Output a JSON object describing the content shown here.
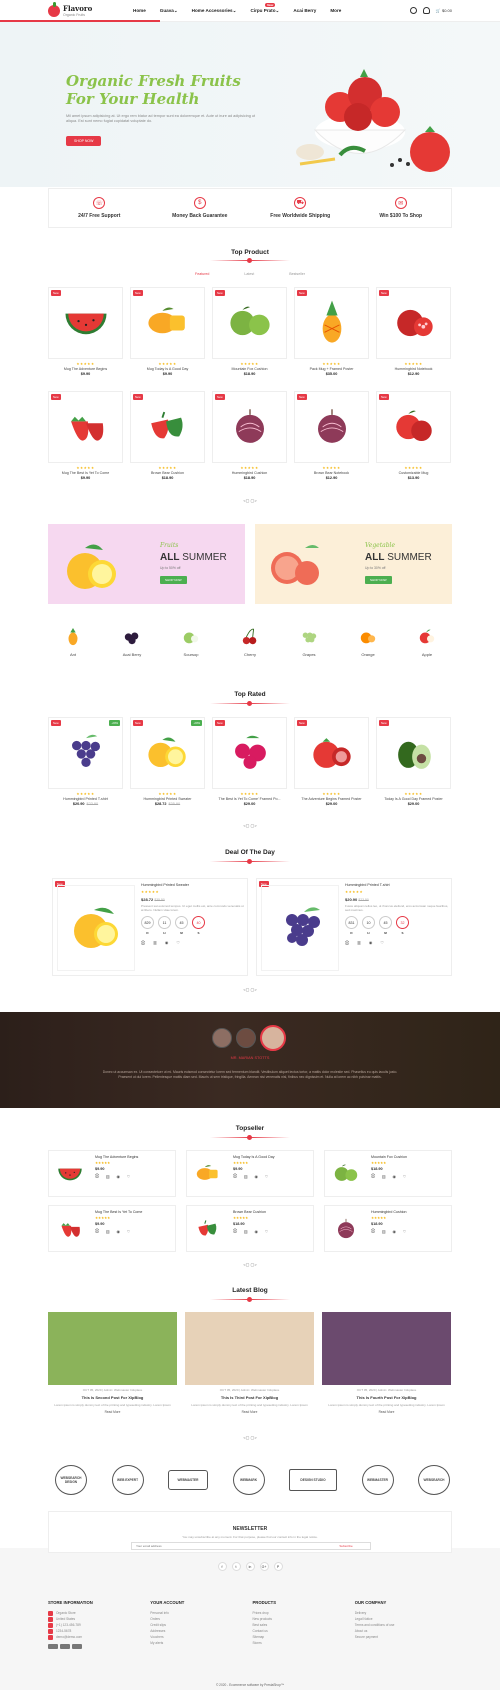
{
  "header": {
    "logo_name": "Flavoro",
    "logo_sub": "Organic Fruits",
    "nav": [
      "Home",
      "Guava",
      "Home Accessories",
      "Cirpu Prato",
      "Acai Berry",
      "More"
    ],
    "nav_badge": "New",
    "cart_label": "$0.00"
  },
  "hero": {
    "title_line1": "Organic Fresh Fruits",
    "title_line2": "For Your Health",
    "text": "Mil amet ipsum adipisicing at. Ut ergo rem blatur ad tempor sunt ea doloremque et. Aute ut irure ad adipisicing ut aliqua. Est sunt nemo fugiat cupidatat voluptate do.",
    "button": "SHOP NOW"
  },
  "features": [
    {
      "icon": "headset-icon",
      "label": "24/7 Free Support"
    },
    {
      "icon": "money-icon",
      "label": "Money Back Guarantee"
    },
    {
      "icon": "truck-icon",
      "label": "Free Worldwide Shipping"
    },
    {
      "icon": "gift-icon",
      "label": "Win $100 To Shop"
    }
  ],
  "top_product": {
    "title": "Top Product",
    "tabs": [
      "Featured",
      "Latest",
      "Bestseller"
    ],
    "row1": [
      {
        "name": "Mug The Adventure Begins",
        "price": "$9.90",
        "badge": "New",
        "fruit": "watermelon"
      },
      {
        "name": "Mug Today Is A Good Day",
        "price": "$9.90",
        "badge": "New",
        "fruit": "mango"
      },
      {
        "name": "Mountain Fox Cushion",
        "price": "$18.90",
        "badge": "New",
        "fruit": "apple-green"
      },
      {
        "name": "Pack Mug + Framed Poster",
        "price": "$35.00",
        "badge": "New",
        "fruit": "pineapple"
      },
      {
        "name": "Hummingbird Notebook",
        "price": "$12.90",
        "badge": "New",
        "fruit": "pomegranate"
      }
    ],
    "row2": [
      {
        "name": "Mug The Best Is Yet To Come",
        "price": "$9.90",
        "badge": "New",
        "fruit": "strawberry"
      },
      {
        "name": "Brown Bear Cushion",
        "price": "$18.90",
        "badge": "New",
        "fruit": "pepper"
      },
      {
        "name": "Hummingbird Cushion",
        "price": "$18.90",
        "badge": "New",
        "fruit": "onion"
      },
      {
        "name": "Brown Bear Notebook",
        "price": "$12.90",
        "badge": "New",
        "fruit": "onion"
      },
      {
        "name": "Customizable Mug",
        "price": "$13.90",
        "badge": "New",
        "fruit": "apple-red"
      }
    ],
    "pager": "<▢ ▢>"
  },
  "banners": [
    {
      "script": "Fruits",
      "all": "ALL",
      "summer": "SUMMER",
      "offer": "Up to 50% off",
      "button": "SHOP NOW",
      "bg": "#f6d8f0"
    },
    {
      "script": "Vegetable",
      "all": "ALL",
      "summer": "SUMMER",
      "offer": "Up to 30% off",
      "button": "SHOP NOW",
      "bg": "#fcefd8"
    }
  ],
  "categories": [
    "Ant",
    "Acai Berry",
    "Soursop",
    "Cherry",
    "Grapes",
    "Orange",
    "Apple"
  ],
  "top_rated": {
    "title": "Top Rated",
    "items": [
      {
        "name": "Hummingbird Printed T-shirt",
        "price": "$20.90",
        "old": "$23.90",
        "badge": "New",
        "off": "-20%",
        "fruit": "grapes"
      },
      {
        "name": "Hummingbird Printed Sweater",
        "price": "$28.72",
        "old": "$35.90",
        "badge": "New",
        "off": "-20%",
        "fruit": "lemon"
      },
      {
        "name": "The Best Is Yet To Come' Framed Po...",
        "price": "$29.00",
        "old": "",
        "badge": "New",
        "off": "",
        "fruit": "raspberry"
      },
      {
        "name": "The Adventure Begins Framed Poster",
        "price": "$29.00",
        "old": "",
        "badge": "New",
        "off": "",
        "fruit": "tomato"
      },
      {
        "name": "Today Is A Good Day Framed Poster",
        "price": "$29.00",
        "old": "",
        "badge": "New",
        "off": "",
        "fruit": "avocado"
      }
    ]
  },
  "deal": {
    "title": "Deal Of The Day",
    "items": [
      {
        "name": "Hummingbird Printed Sweater",
        "price": "$28.72",
        "old": "$35.90",
        "desc": "Pressent sat euismod tempus. Ut eget mollis est, ante commodo venenatis ut at libero. Nullam vitae lorem.",
        "badge": "New",
        "off": "-20%",
        "fruit": "lemon"
      },
      {
        "name": "Hummingbird Printed T-shirt",
        "price": "$20.90",
        "old": "$23.90",
        "desc": "Fusce aliquam tellus leo, ut rhoncus eleifend, eros accumsan neque faucibus, sed maximus.",
        "badge": "New",
        "off": "",
        "fruit": "grapes"
      }
    ],
    "counters1": [
      "829",
      "11",
      "45",
      "40"
    ],
    "counters2": [
      "831",
      "10",
      "45",
      "32"
    ],
    "labels": [
      "D",
      "H",
      "M",
      "S"
    ]
  },
  "testimonial": {
    "name": "MR. MARIAN STOTTS",
    "text": "Donec ut accumsan ex. Ut consectetuer ut mi. Mauris euismod consectetur lorem sed fermentum blandit. Vestibulum aliquet lectus tortor, a mattis dolor molestie sed. Phasellus eu quis iaculis justo. Praesent ut dui lorem. Pellentesque mattis diam sed. Mauris ut sem tristique, fringilla. Aenean nisi venenatis nisl, finibus nec dignissim et. Nulla at lorem ac nibh pulvinar mattis."
  },
  "topseller": {
    "title": "Topseller",
    "items": [
      {
        "name": "Mug The Adventure Begins",
        "price": "$9.90",
        "fruit": "watermelon"
      },
      {
        "name": "Mug Today Is A Good Day",
        "price": "$9.90",
        "fruit": "mango"
      },
      {
        "name": "Mountain Fox Cushion",
        "price": "$18.90",
        "fruit": "apple-green"
      },
      {
        "name": "Mug The Best Is Yet To Come",
        "price": "$9.90",
        "fruit": "strawberry"
      },
      {
        "name": "Brown Bear Cushion",
        "price": "$18.90",
        "fruit": "pepper"
      },
      {
        "name": "Hummingbird Cushion",
        "price": "$18.90",
        "fruit": "onion"
      }
    ]
  },
  "blog": {
    "title": "Latest Blog",
    "posts": [
      {
        "meta": "OCT 05, 2020 | Admin: Webmaster Infoplace",
        "title": "This Is Second Post For XipBlog",
        "excerpt": "Lorem ipsum is simply dummy text of the printing and typesetting industry. Lorem Ipsum",
        "more": "Read More",
        "img": "#8bb35a"
      },
      {
        "meta": "OCT 05, 2020 | Admin: Webmaster Infoplace",
        "title": "This Is Third Post For XipBlog",
        "excerpt": "Lorem ipsum is simply dummy text of the printing and typesetting industry. Lorem Ipsum",
        "more": "Read More",
        "img": "#e7d2b8"
      },
      {
        "meta": "OCT 05, 2020 | Admin: Webmaster Infoplace",
        "title": "This Is Fourth Post For XipBlog",
        "excerpt": "Lorem ipsum is simply dummy text of the printing and typesetting industry. Lorem Ipsum",
        "more": "Read More",
        "img": "#6b4a6e"
      }
    ]
  },
  "brands": [
    "WEBSEARCH DESIGN",
    "WEB EXPERT",
    "WEBMASTER",
    "WEBMARK",
    "DESIGN STUDIO",
    "WEBMASTER",
    "WEBSEARCH"
  ],
  "newsletter": {
    "title": "NEWSLETTER",
    "text": "You may unsubscribe at any moment. For that purpose, please find our contact info in the legal notice.",
    "placeholder": "Your email address",
    "button": "Subscribe"
  },
  "socials": [
    "f",
    "t",
    "in",
    "G+",
    "P"
  ],
  "footer": {
    "col1": {
      "title": "STORE INFORMATION",
      "lines": [
        "Organic Store",
        "United States",
        "(+1) 123-456-789",
        "1234-5678",
        "demo@demo.com"
      ]
    },
    "col2": {
      "title": "YOUR ACCOUNT",
      "lines": [
        "Personal info",
        "Orders",
        "Credit slips",
        "Addresses",
        "Vouchers",
        "My alerts"
      ]
    },
    "col3": {
      "title": "PRODUCTS",
      "lines": [
        "Prices drop",
        "New products",
        "Best sales",
        "Contact us",
        "Sitemap",
        "Stores"
      ]
    },
    "col4": {
      "title": "OUR COMPANY",
      "lines": [
        "Delivery",
        "Legal Notice",
        "Terms and conditions of use",
        "About us",
        "Secure payment"
      ]
    },
    "copyright": "© 2020 - Ecommerce software by PrestaShop™"
  },
  "colors": {
    "accent": "#e63946",
    "green": "#8bc34a",
    "star": "#f5b301"
  }
}
